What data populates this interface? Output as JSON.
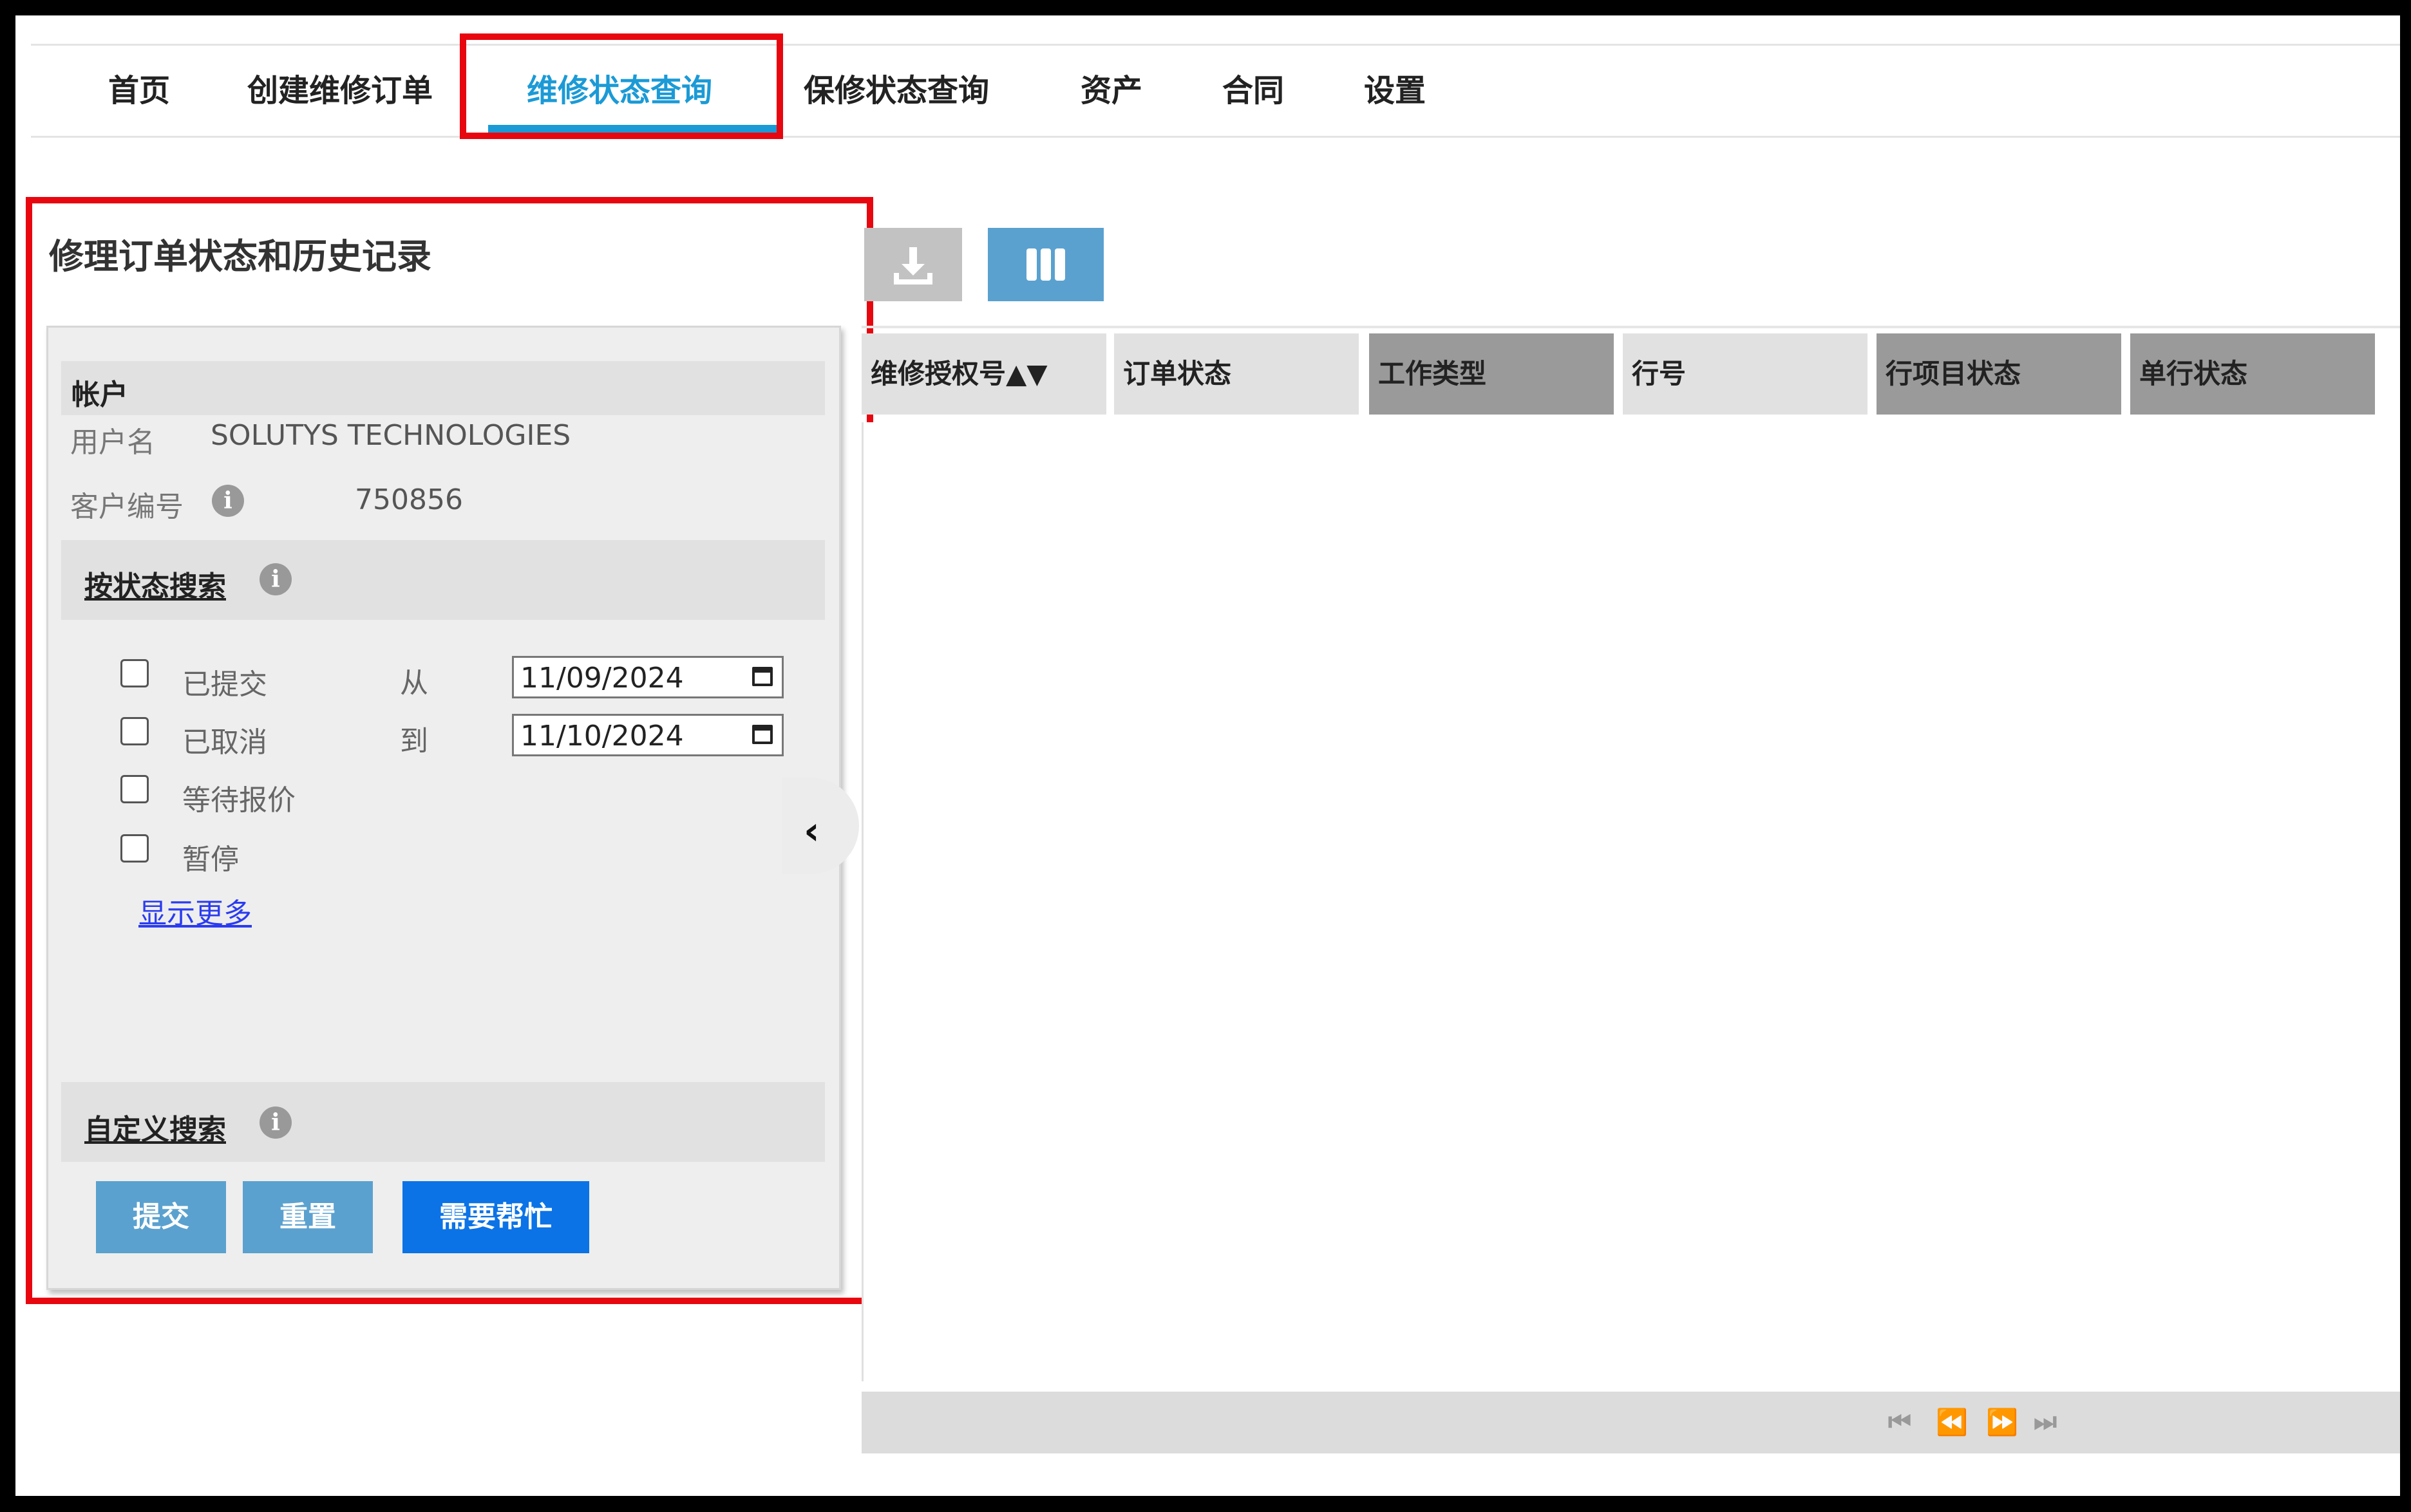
{
  "nav": {
    "items": [
      {
        "label": "首页"
      },
      {
        "label": "创建维修订单"
      },
      {
        "label": "维修状态查询"
      },
      {
        "label": "保修状态查询"
      },
      {
        "label": "资产"
      },
      {
        "label": "合同"
      },
      {
        "label": "设置"
      }
    ],
    "active_index": 2,
    "accent_color": "#1b9ad6"
  },
  "panel": {
    "title": "修理订单状态和历史记录",
    "account": {
      "title": "帐户",
      "username_label": "用户名",
      "username_value": "SOLUTYS TECHNOLOGIES",
      "customer_no_label": "客户编号",
      "customer_no_value": "750856"
    },
    "status_search": {
      "title": "按状态搜索",
      "options": [
        {
          "label": "已提交",
          "checked": false
        },
        {
          "label": "已取消",
          "checked": false
        },
        {
          "label": "等待报价",
          "checked": false
        },
        {
          "label": "暂停",
          "checked": false
        }
      ],
      "from_label": "从",
      "to_label": "到",
      "from_date": "11/09/2024",
      "to_date": "11/10/2024",
      "show_more": "显示更多"
    },
    "custom_search": {
      "title": "自定义搜索"
    },
    "buttons": {
      "submit": "提交",
      "reset": "重置",
      "help": "需要帮忙"
    }
  },
  "grid": {
    "columns": [
      {
        "label": "维修授权号▲▼"
      },
      {
        "label": "订单状态"
      },
      {
        "label": "工作类型"
      },
      {
        "label": "行号"
      },
      {
        "label": "行项目状态"
      },
      {
        "label": "单行状态"
      }
    ],
    "rows": []
  },
  "icons": {
    "download": "download-icon",
    "columns": "columns-icon",
    "info": "info-icon",
    "calendar": "calendar-icon",
    "collapse": "chevron-left-icon",
    "pager": [
      "first-page-icon",
      "prev-page-icon",
      "next-page-icon",
      "last-page-icon"
    ]
  },
  "colors": {
    "highlight": "#e8060f",
    "button_blue": "#5aa1cf",
    "help_blue": "#0b73e6"
  }
}
